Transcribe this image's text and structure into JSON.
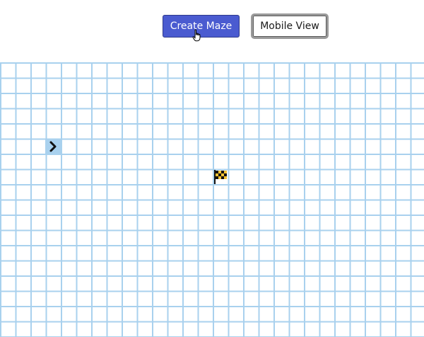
{
  "toolbar": {
    "create_maze_label": "Create Maze",
    "mobile_view_label": "Mobile View"
  },
  "maze": {
    "player_icon": "chevron-right-icon",
    "goal_icon": "checkered-flag-icon",
    "grid_color": "#a9d1ee"
  },
  "colors": {
    "primary_button": "#4a5bd0",
    "primary_button_text": "#ffffff",
    "secondary_button_border": "#9a9a9a"
  }
}
